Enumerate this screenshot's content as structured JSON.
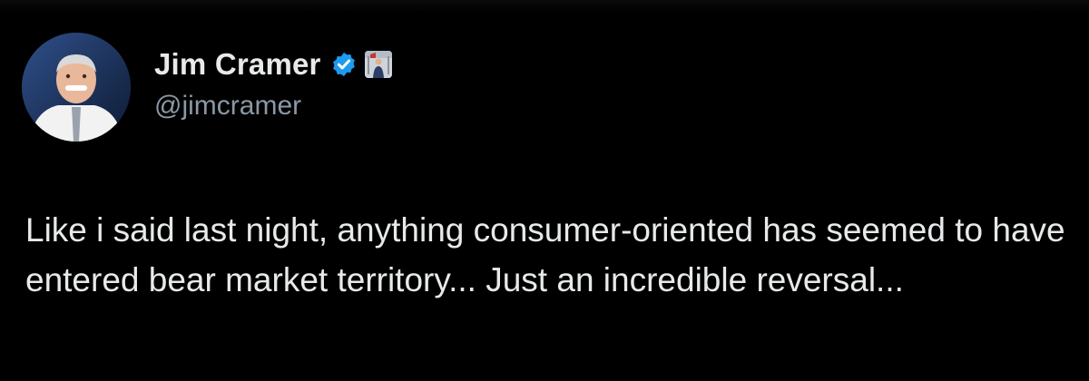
{
  "colors": {
    "background": "#000000",
    "primary_text": "#e7e9ea",
    "secondary_text": "#8b98a5",
    "verified_blue": "#1d9bf0"
  },
  "author": {
    "display_name": "Jim Cramer",
    "handle": "@jimcramer",
    "verified": true,
    "avatar_icon": "profile-photo",
    "badge_icon": "affiliate-badge"
  },
  "tweet": {
    "text": "Like i said last night, anything consumer-oriented has seemed to have entered bear market territory... Just an incredible reversal..."
  }
}
